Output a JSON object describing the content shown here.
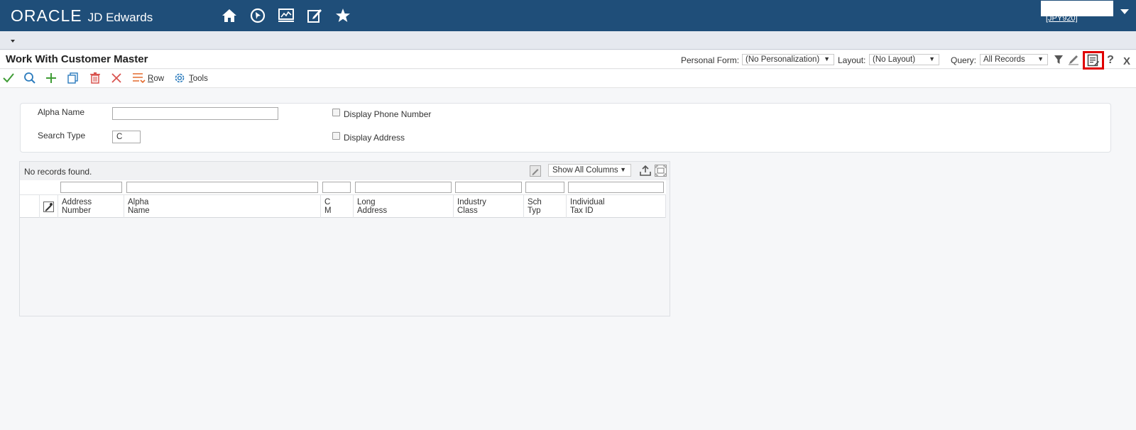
{
  "banner": {
    "logo_oracle": "ORACLE",
    "logo_product": "JD Edwards",
    "nav_icons": [
      "home-icon",
      "recent-icon",
      "monitor-icon",
      "edit-icon",
      "favorites-icon"
    ],
    "environment": "[JPY920]",
    "background_color": "#1f4e79"
  },
  "form": {
    "title": "Work With Customer Master",
    "personal_form_label": "Personal Form:",
    "personal_form_value": "(No Personalization)",
    "layout_label": "Layout:",
    "layout_value": "(No Layout)",
    "query_label": "Query:",
    "query_value": "All Records",
    "header_icons": [
      "filter-icon",
      "pencil-icon",
      "notes-icon",
      "help-icon",
      "close-icon"
    ]
  },
  "toolbar": {
    "buttons": [
      "select-icon",
      "find-icon",
      "add-icon",
      "copy-icon",
      "delete-icon",
      "cancel-icon"
    ],
    "row_label_u": "R",
    "row_label_rest": "ow",
    "tools_label_u": "T",
    "tools_label_rest": "ools"
  },
  "search": {
    "alpha_name_label": "Alpha Name",
    "alpha_name_value": "",
    "search_type_label": "Search Type",
    "search_type_value": "C",
    "display_phone_label": "Display Phone Number",
    "display_phone_checked": false,
    "display_address_label": "Display Address",
    "display_address_checked": false
  },
  "grid": {
    "status": "No records found.",
    "columns_select": "Show All Columns",
    "columns": [
      {
        "line1": "Address",
        "line2": "Number"
      },
      {
        "line1": "Alpha",
        "line2": "Name"
      },
      {
        "line1": "C",
        "line2": "M"
      },
      {
        "line1": "Long",
        "line2": "Address"
      },
      {
        "line1": "Industry",
        "line2": "Class"
      },
      {
        "line1": "Sch",
        "line2": "Typ"
      },
      {
        "line1": "Individual",
        "line2": "Tax ID"
      }
    ],
    "rows": []
  }
}
